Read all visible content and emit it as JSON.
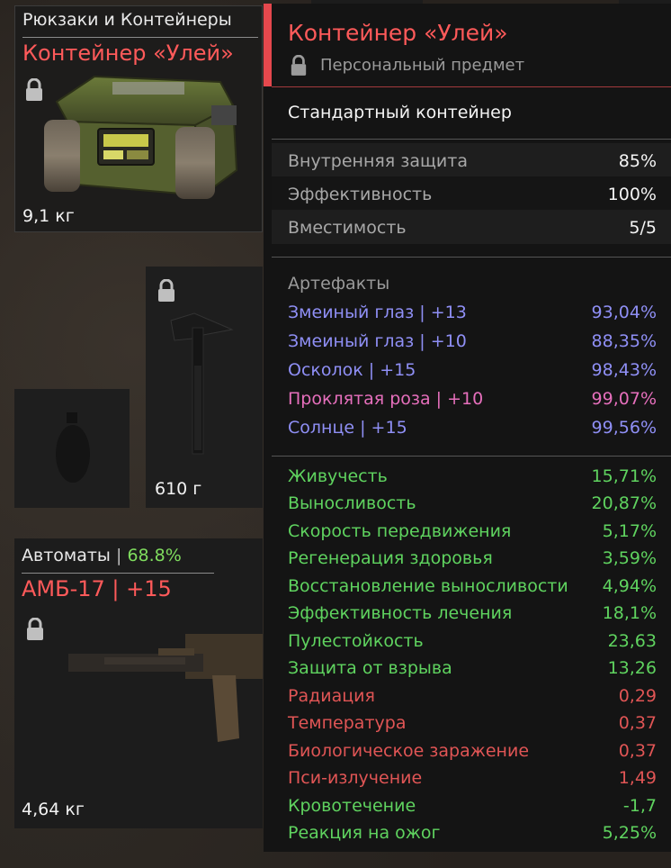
{
  "slots": {
    "container": {
      "category": "Рюкзаки и Контейнеры",
      "name": "Контейнер «Улей»",
      "weight": "9,1 кг"
    },
    "axe": {
      "weight": "610 г"
    },
    "rifle": {
      "category": "Автоматы",
      "category_sep": "|",
      "category_value": "68.8%",
      "name": "АМБ-17 | +15",
      "weight": "4,64 кг"
    }
  },
  "tooltip": {
    "title": "Контейнер «Улей»",
    "subtitle": "Персональный предмет",
    "type": "Стандартный контейнер",
    "basic_stats": [
      {
        "label": "Внутренняя защита",
        "value": "85%"
      },
      {
        "label": "Эффективность",
        "value": "100%"
      },
      {
        "label": "Вместимость",
        "value": "5/5"
      }
    ],
    "artifacts_header": "Артефакты",
    "artifacts": [
      {
        "label": "Змеиный глаз | +13",
        "value": "93,04%",
        "color": "#8f8ff5"
      },
      {
        "label": "Змеиный глаз | +10",
        "value": "88,35%",
        "color": "#8f8ff5"
      },
      {
        "label": "Осколок | +15",
        "value": "98,43%",
        "color": "#8f8ff5"
      },
      {
        "label": "Проклятая роза | +10",
        "value": "99,07%",
        "color": "#e66fbc"
      },
      {
        "label": "Солнце | +15",
        "value": "99,56%",
        "color": "#8f8ff5"
      }
    ],
    "effects": [
      {
        "label": "Живучесть",
        "value": "15,71%",
        "color": "#5fd35f"
      },
      {
        "label": "Выносливость",
        "value": "20,87%",
        "color": "#5fd35f"
      },
      {
        "label": "Скорость передвижения",
        "value": "5,17%",
        "color": "#5fd35f"
      },
      {
        "label": "Регенерация здоровья",
        "value": "3,59%",
        "color": "#5fd35f"
      },
      {
        "label": "Восстановление выносливости",
        "value": "4,94%",
        "color": "#5fd35f"
      },
      {
        "label": "Эффективность лечения",
        "value": "18,1%",
        "color": "#5fd35f"
      },
      {
        "label": "Пулестойкость",
        "value": "23,63",
        "color": "#5fd35f"
      },
      {
        "label": "Защита от взрыва",
        "value": "13,26",
        "color": "#5fd35f"
      },
      {
        "label": "Радиация",
        "value": "0,29",
        "color": "#e05555"
      },
      {
        "label": "Температура",
        "value": "0,37",
        "color": "#e05555"
      },
      {
        "label": "Биологическое заражение",
        "value": "0,37",
        "color": "#e05555"
      },
      {
        "label": "Пси-излучение",
        "value": "1,49",
        "color": "#e05555"
      },
      {
        "label": "Кровотечение",
        "value": "-1,7",
        "color": "#5fd35f"
      },
      {
        "label": "Реакция на ожог",
        "value": "5,25%",
        "color": "#5fd35f"
      }
    ]
  },
  "icons": [
    "lock-icon",
    "container-image",
    "axe-image",
    "grenade-image",
    "rifle-image"
  ],
  "colors": {
    "accent": "#e5484d",
    "item_name": "#ff5a5a",
    "positive": "#5fd35f",
    "negative": "#e05555",
    "artifact": "#8f8ff5",
    "artifact_rare": "#e66fbc"
  }
}
